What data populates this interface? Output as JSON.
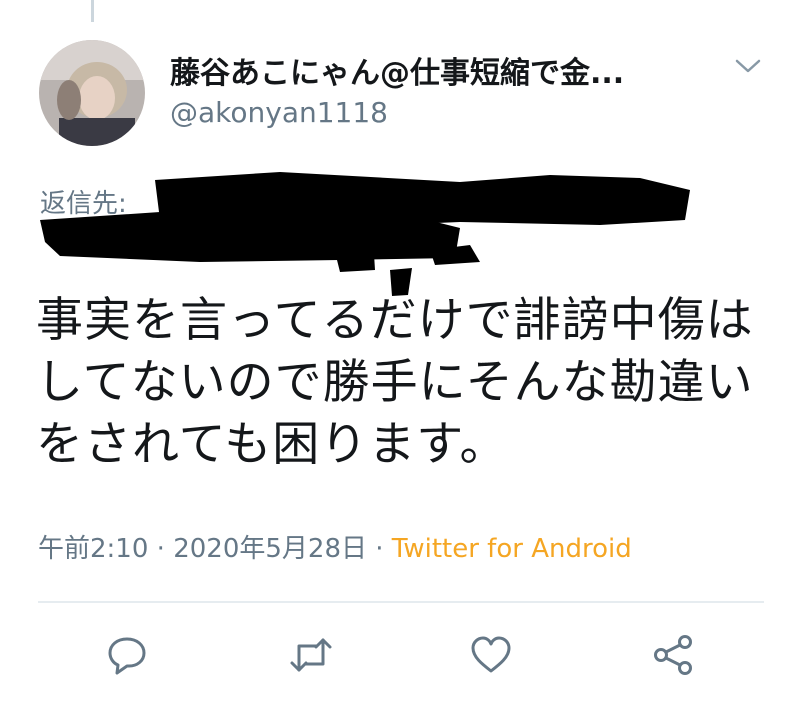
{
  "tweet": {
    "display_name": "藤谷あこにゃん@仕事短縮で金...",
    "handle": "@akonyan1118",
    "reply_prefix": "返信先:",
    "text": "事実を言ってるだけで誹謗中傷はしてないので勝手にそんな勘違いをされても困ります。",
    "time": "午前2:10",
    "separator": " · ",
    "date": "2020年5月28日",
    "source": "Twitter for Android"
  },
  "icons": {
    "more": "chevron-down-icon",
    "reply": "reply-icon",
    "retweet": "retweet-icon",
    "like": "heart-icon",
    "share": "share-icon"
  },
  "colors": {
    "text": "#14171a",
    "secondary": "#657786",
    "source": "#f5a623",
    "icon": "#657786",
    "divider": "#e6ecf0"
  }
}
